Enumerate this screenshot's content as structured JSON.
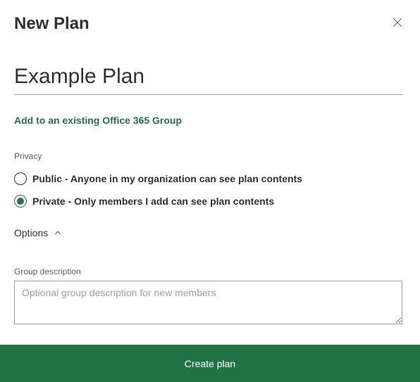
{
  "header": {
    "title": "New Plan"
  },
  "planName": {
    "value": "Example Plan"
  },
  "addGroupLink": "Add to an existing Office 365 Group",
  "privacy": {
    "label": "Privacy",
    "options": [
      {
        "label": "Public - Anyone in my organization can see plan contents",
        "selected": false
      },
      {
        "label": "Private - Only members I add can see plan contents",
        "selected": true
      }
    ]
  },
  "optionsToggle": {
    "label": "Options"
  },
  "groupDescription": {
    "label": "Group description",
    "placeholder": "Optional group description for new members",
    "value": ""
  },
  "footer": {
    "createButton": "Create plan"
  }
}
